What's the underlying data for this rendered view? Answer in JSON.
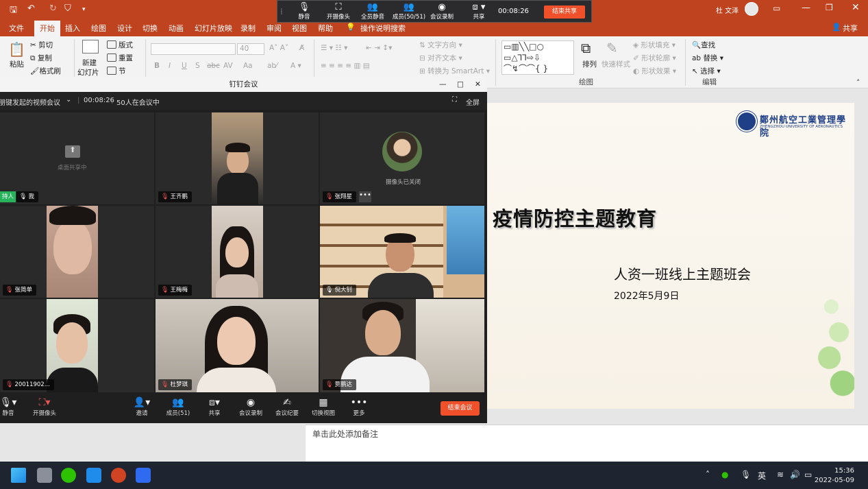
{
  "ppt": {
    "user": "杜 文泽",
    "share_label": "共享",
    "tabs": [
      "文件",
      "开始",
      "插入",
      "绘图",
      "设计",
      "切换",
      "动画",
      "幻灯片放映",
      "录制",
      "审阅",
      "视图",
      "帮助"
    ],
    "tell_me": "操作说明搜索",
    "ribbon": {
      "paste": "粘贴",
      "cut": "剪切",
      "copy": "复制",
      "format_painter": "格式刷",
      "new_slide": "新建",
      "new_slide2": "幻灯片",
      "layout": "版式",
      "reset": "重置",
      "section": "节",
      "font_size": "40",
      "text_direction": "文字方向",
      "align_text": "对齐文本",
      "smartart": "转换为 SmartArt",
      "arrange": "排列",
      "quick_styles": "快速样式",
      "shape_fill": "形状填充",
      "shape_outline": "形状轮廓",
      "shape_effects": "形状效果",
      "find": "查找",
      "replace": "替换",
      "select": "选择",
      "group_drawing": "绘图",
      "group_editing": "编辑",
      "bold": "B",
      "italic": "I",
      "underline": "U",
      "shadow": "S",
      "strike": "abc",
      "spacing": "AV",
      "case": "Aa"
    },
    "notes_placeholder": "单击此处添加备注"
  },
  "share_bar": {
    "mute": "静音",
    "camera": "开摄像头",
    "mute_all": "全员静音",
    "members": "成员(50/51)",
    "record": "会议录制",
    "share": "共享",
    "timer": "00:08:26",
    "stop_share": "结束共享"
  },
  "slide": {
    "title": "疫情防控主题教育",
    "subtitle": "人资一班线上主题班会",
    "date": "2022年5月9日",
    "logo_cn": "鄭州航空工業管理學院",
    "logo_en": "ZHENGZHOU UNIVERSITY OF AERONAUTICS"
  },
  "meeting": {
    "window_title": "钉钉会议",
    "meeting_name": "李朋键发起的视频会议",
    "timer": "00:08:26",
    "count": "50人在会议中",
    "fullscreen": "全屏",
    "tiles": [
      {
        "name": "我",
        "note": "桌面共享中",
        "host": "持人"
      },
      {
        "name": "王齐鹏"
      },
      {
        "name": "张翔星",
        "note": "摄像头已关闭"
      },
      {
        "name": "张简单"
      },
      {
        "name": "王梅梅"
      },
      {
        "name": "倪大钊"
      },
      {
        "name": "20011902..."
      },
      {
        "name": "杜梦琪"
      },
      {
        "name": "贾鹏达"
      }
    ],
    "controls": {
      "mute": "静音",
      "camera": "开摄像头",
      "invite": "邀请",
      "members": "成员(51)",
      "share": "共享",
      "record": "会议录制",
      "minutes": "会议纪要",
      "switch": "切换视图",
      "more": "更多",
      "end": "结束会议"
    }
  },
  "taskbar": {
    "ime": "英",
    "time": "15:36",
    "date": "2022-05-09"
  },
  "colors": {
    "ppt_accent": "#c0431f",
    "end_button": "#f0502a",
    "logo_blue": "#1f3f87"
  }
}
